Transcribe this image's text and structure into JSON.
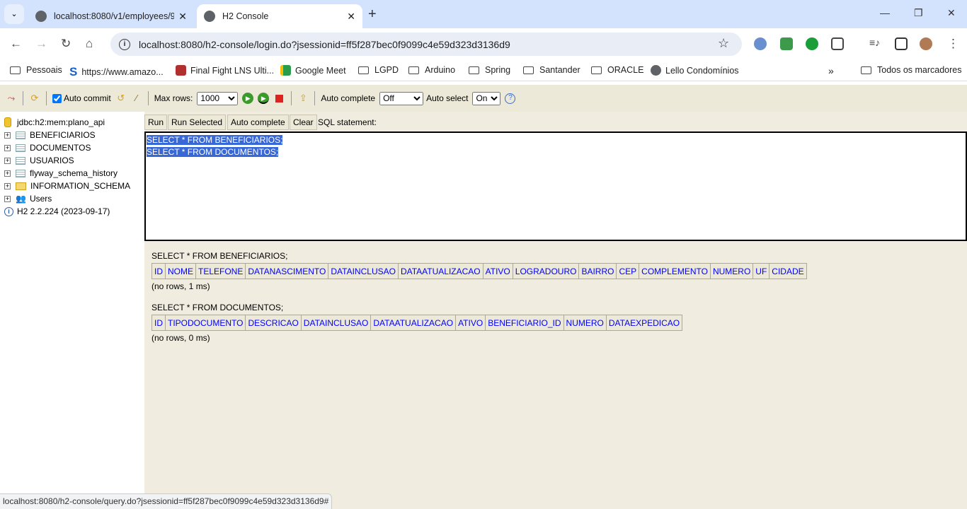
{
  "browser": {
    "tabs": [
      {
        "label": "localhost:8080/v1/employees/9",
        "active": false
      },
      {
        "label": "H2 Console",
        "active": true
      }
    ],
    "url": "localhost:8080/h2-console/login.do?jsessionid=ff5f287bec0f9099c4e59d323d3136d9",
    "bookmarks": [
      "Pessoais",
      "https://www.amazo...",
      "Final Fight LNS Ulti...",
      "Google Meet",
      "LGPD",
      "Arduino",
      "Spring",
      "Santander",
      "ORACLE",
      "Lello Condomínios"
    ],
    "all_bookmarks": "Todos os marcadores",
    "status_url": "localhost:8080/h2-console/query.do?jsessionid=ff5f287bec0f9099c4e59d323d3136d9#"
  },
  "toolbar": {
    "auto_commit": "Auto commit",
    "auto_commit_checked": true,
    "max_rows_label": "Max rows:",
    "max_rows": "1000",
    "auto_complete_label": "Auto complete",
    "auto_complete": "Off",
    "auto_select_label": "Auto select",
    "auto_select": "On"
  },
  "tree": {
    "connection": "jdbc:h2:mem:plano_api",
    "items": [
      "BENEFICIARIOS",
      "DOCUMENTOS",
      "USUARIOS",
      "flyway_schema_history",
      "INFORMATION_SCHEMA",
      "Users"
    ],
    "version": "H2 2.2.224 (2023-09-17)"
  },
  "sql": {
    "run": "Run",
    "run_selected": "Run Selected",
    "auto_complete": "Auto complete",
    "clear": "Clear",
    "label": "SQL statement:",
    "lines": [
      "SELECT * FROM BENEFICIARIOS;",
      "SELECT * FROM DOCUMENTOS;"
    ]
  },
  "results": [
    {
      "query": "SELECT * FROM BENEFICIARIOS;",
      "columns": [
        "ID",
        "NOME",
        "TELEFONE",
        "DATANASCIMENTO",
        "DATAINCLUSAO",
        "DATAATUALIZACAO",
        "ATIVO",
        "LOGRADOURO",
        "BAIRRO",
        "CEP",
        "COMPLEMENTO",
        "NUMERO",
        "UF",
        "CIDADE"
      ],
      "info": "(no rows, 1 ms)"
    },
    {
      "query": "SELECT * FROM DOCUMENTOS;",
      "columns": [
        "ID",
        "TIPODOCUMENTO",
        "DESCRICAO",
        "DATAINCLUSAO",
        "DATAATUALIZACAO",
        "ATIVO",
        "BENEFICIARIO_ID",
        "NUMERO",
        "DATAEXPEDICAO"
      ],
      "info": "(no rows, 0 ms)"
    }
  ]
}
